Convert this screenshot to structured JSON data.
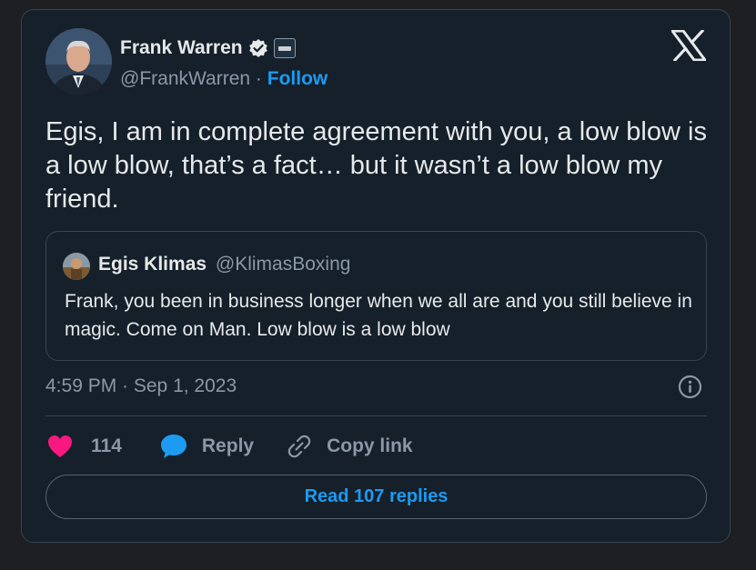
{
  "author": {
    "name": "Frank Warren",
    "handle": "@FrankWarren",
    "separator": "·",
    "follow_label": "Follow"
  },
  "tweet": {
    "text": "Egis, I am in complete agreement with you, a low blow is a low blow, that’s a fact… but it wasn’t a low blow my friend."
  },
  "quote": {
    "name": "Egis Klimas",
    "handle": "@KlimasBoxing",
    "text": "Frank, you been in business longer when we all are and you still believe in magic. Come on Man. Low blow is a low blow"
  },
  "meta": {
    "timestamp": "4:59 PM · Sep 1, 2023"
  },
  "actions": {
    "like_count": "114",
    "reply_label": "Reply",
    "copy_link_label": "Copy link"
  },
  "read_replies_label": "Read 107 replies",
  "colors": {
    "background": "#15202b",
    "accent": "#1d9bf0",
    "like": "#f91880",
    "muted": "#8b98a5"
  }
}
